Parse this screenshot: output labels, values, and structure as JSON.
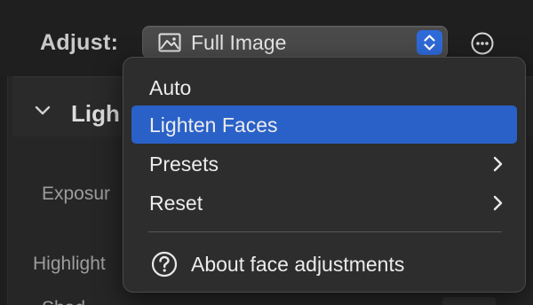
{
  "toolbar": {
    "adjust_label": "Adjust:",
    "scope_value": "Full Image",
    "scope_icon": "image-icon",
    "more_icon": "ellipsis-circle-icon"
  },
  "panel": {
    "section_title": "Ligh",
    "labels": [
      "Exposur",
      "Highlight",
      "Shad"
    ]
  },
  "menu": {
    "items": [
      {
        "label": "Auto",
        "highlighted": false,
        "submenu": false
      },
      {
        "label": "Lighten Faces",
        "highlighted": true,
        "submenu": false
      },
      {
        "label": "Presets",
        "highlighted": false,
        "submenu": true
      },
      {
        "label": "Reset",
        "highlighted": false,
        "submenu": true
      }
    ],
    "help_label": "About face adjustments",
    "help_icon": "question-circle-icon"
  },
  "colors": {
    "accent": "#2a61c8",
    "menu_bg": "#2d2d2d",
    "background": "#1e1e1e"
  }
}
